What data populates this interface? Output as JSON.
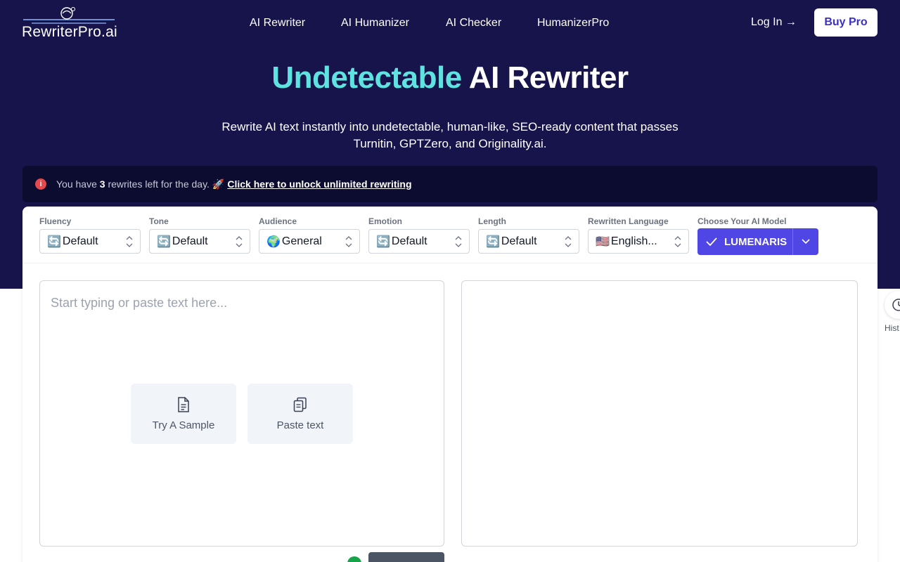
{
  "header": {
    "logo_text": "RewriterPro.ai",
    "nav": [
      "AI Rewriter",
      "AI Humanizer",
      "AI Checker",
      "HumanizerPro"
    ],
    "login": "Log In →",
    "buy_pro": "Buy Pro"
  },
  "hero": {
    "title_accent": "Undetectable",
    "title_rest": "AI Rewriter",
    "subtitle": "Rewrite AI text instantly into undetectable, human-like, SEO-ready content that passes Turnitin, GPTZero, and Originality.ai."
  },
  "notice": {
    "prefix": "You have",
    "count": "3",
    "suffix": "rewrites left for the day.",
    "link_emoji": "🚀",
    "link": "Click here to unlock unlimited rewriting"
  },
  "controls": [
    {
      "label": "Fluency",
      "emoji": "🔄",
      "value": "Default"
    },
    {
      "label": "Tone",
      "emoji": "🔄",
      "value": "Default"
    },
    {
      "label": "Audience",
      "emoji": "🌍",
      "value": "General"
    },
    {
      "label": "Emotion",
      "emoji": "🔄",
      "value": "Default"
    },
    {
      "label": "Length",
      "emoji": "🔄",
      "value": "Default"
    },
    {
      "label": "Rewritten Language",
      "emoji": "🇺🇸",
      "value": "English..."
    }
  ],
  "model": {
    "label": "Choose Your AI Model",
    "value": "LUMENARIS"
  },
  "editor": {
    "placeholder": "Start typing or paste text here...",
    "try_sample": "Try A Sample",
    "paste_text": "Paste text"
  },
  "history_label": "Hist",
  "colors": {
    "hero_bg": "#16144a",
    "accent": "#5ee3e0",
    "primary": "#4f46e5"
  }
}
